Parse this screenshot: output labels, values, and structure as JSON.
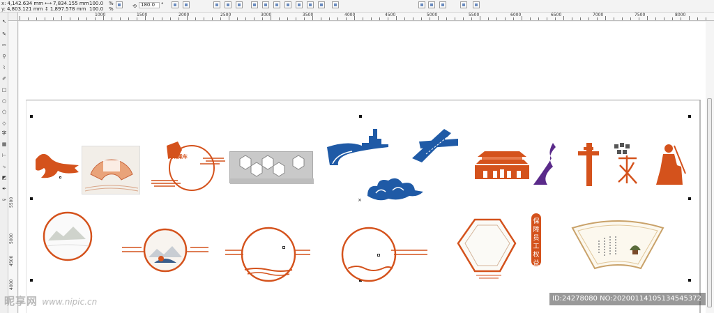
{
  "property_bar": {
    "x_label": "x:",
    "x_value": "4,142.634 mm",
    "y_label": "y:",
    "y_value": "4,803.121 mm",
    "width_value": "7,834.155 mm",
    "height_value": "1,897.578 mm",
    "scale_x": "100.0",
    "scale_y": "100.0",
    "percent_1": "%",
    "percent_2": "%",
    "rotation": "180.0",
    "degree": "°"
  },
  "ruler": {
    "h_labels": [
      "1000",
      "1500",
      "2000",
      "2500",
      "3000",
      "3500",
      "4000",
      "4500",
      "5000",
      "5500",
      "6000",
      "6500",
      "7000",
      "7500",
      "8000"
    ],
    "v_labels": [
      "5500",
      "5000",
      "4500",
      "4000"
    ]
  },
  "artwork": {
    "badge_text": "保障员工权益",
    "sign_text": "文明乘车"
  },
  "watermark": {
    "site_name": "昵享网",
    "site_url": "www.nipic.cn",
    "id_text": "ID:24278080 NO:20200114105134545372"
  },
  "colors": {
    "accent_orange": "#d4521c",
    "accent_blue": "#1f5aa6",
    "accent_purple": "#5a2a8a"
  }
}
